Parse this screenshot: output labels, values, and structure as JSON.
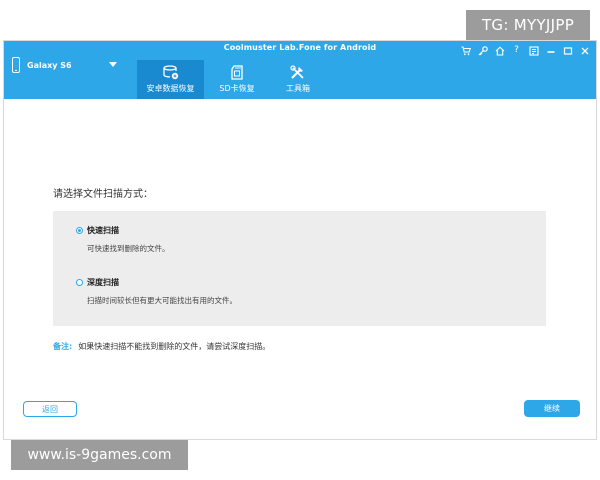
{
  "window": {
    "title": "Coolmuster Lab.Fone for Android",
    "device_name": "Galaxy S6",
    "controls": [
      "cart-icon",
      "key-icon",
      "home-icon",
      "help-icon",
      "feedback-icon",
      "minimize-icon",
      "maximize-icon",
      "close-icon"
    ]
  },
  "tabs": [
    {
      "label": "安卓数据恢复",
      "icon": "database-restore-icon",
      "active": true
    },
    {
      "label": "SD卡恢复",
      "icon": "sd-card-icon",
      "active": false
    },
    {
      "label": "工具箱",
      "icon": "toolbox-icon",
      "active": false
    }
  ],
  "main": {
    "prompt": "请选择文件扫描方式：",
    "options": [
      {
        "title": "快速扫描",
        "description": "可快速找到删除的文件。",
        "selected": true
      },
      {
        "title": "深度扫描",
        "description": "扫描时间较长但有更大可能找出有用的文件。",
        "selected": false
      }
    ],
    "note_label": "备注:",
    "note_text": "如果快速扫描不能找到删除的文件，请尝试深度扫描。"
  },
  "buttons": {
    "back": "返回",
    "next": "继续"
  },
  "watermarks": {
    "tg": "TG: MYYJJPP",
    "site": "www.is-9games.com"
  },
  "colors": {
    "accent": "#2ea7e8",
    "active_tab": "#1989d0",
    "options_bg": "#ededed",
    "watermark_bg": "#9c9c9c"
  }
}
